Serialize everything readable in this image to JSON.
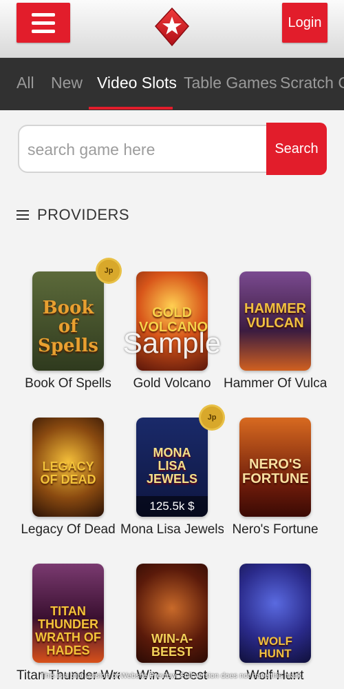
{
  "header": {
    "login_label": "Login",
    "menu_icon": "hamburger-menu-icon",
    "logo_icon": "red-diamond-star-logo"
  },
  "tabs": [
    {
      "label": "All",
      "active": false
    },
    {
      "label": "New",
      "active": false
    },
    {
      "label": "Video Slots",
      "active": true
    },
    {
      "label": "Table Games",
      "active": false
    },
    {
      "label": "Scratch Ca",
      "active": false
    }
  ],
  "search": {
    "placeholder": "search game here",
    "button_label": "Search"
  },
  "providers": {
    "label": "PROVIDERS"
  },
  "games": [
    {
      "name": "Book Of Spells",
      "art": "Book of Spells",
      "jp": "Jp"
    },
    {
      "name": "Gold Volcano",
      "art": "GOLD VOLCANO",
      "jp": ""
    },
    {
      "name": "Hammer Of Vulcan",
      "art": "HAMMER VULCAN",
      "jp": ""
    },
    {
      "name": "Legacy Of Dead",
      "art": "LEGACY OF DEAD",
      "jp": ""
    },
    {
      "name": "Mona Lisa Jewels",
      "art": "MONA LISA JEWELS",
      "jp": "Jp",
      "jackpot": "125.5k $"
    },
    {
      "name": "Nero's Fortune",
      "art": "NERO'S FORTUNE",
      "jp": ""
    },
    {
      "name": "Titan Thunder Wrat...",
      "art": "TITAN THUNDER WRATH OF HADES",
      "jp": ""
    },
    {
      "name": "Win A Beest",
      "art": "WIN-A-BEEST",
      "jp": ""
    },
    {
      "name": "Wolf Hunt",
      "art": "WOLF HUNT",
      "jp": ""
    }
  ],
  "watermark": "Sample",
  "footnote": "This is a trial version of Website Preview. Full version does not have this mark.",
  "colors": {
    "accent": "#e21d2b",
    "tab_bar": "#313131",
    "jp_badge": "#d8a82b"
  }
}
